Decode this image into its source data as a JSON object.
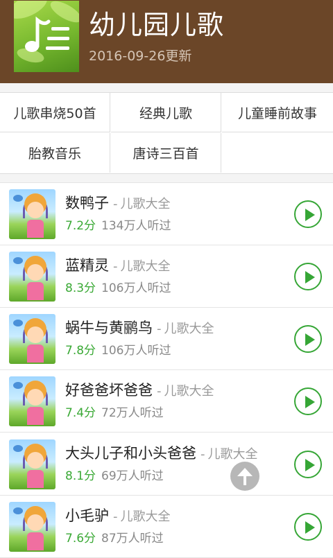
{
  "header": {
    "title": "幼儿园儿歌",
    "updated": "2016-09-26更新",
    "icon": "music-note-icon"
  },
  "categories": [
    {
      "label": "儿歌串烧50首"
    },
    {
      "label": "经典儿歌"
    },
    {
      "label": "儿童睡前故事"
    },
    {
      "label": "胎教音乐"
    },
    {
      "label": "唐诗三百首"
    }
  ],
  "songs": [
    {
      "title": "数鸭子",
      "sep": "-",
      "category": "儿歌大全",
      "score": "7.2分",
      "listens": "134万人听过"
    },
    {
      "title": "蓝精灵",
      "sep": "-",
      "category": "儿歌大全",
      "score": "8.3分",
      "listens": "106万人听过"
    },
    {
      "title": "蜗牛与黄鹂鸟",
      "sep": "-",
      "category": "儿歌大全",
      "score": "7.8分",
      "listens": "106万人听过"
    },
    {
      "title": "好爸爸坏爸爸",
      "sep": "-",
      "category": "儿歌大全",
      "score": "7.4分",
      "listens": "72万人听过"
    },
    {
      "title": "大头儿子和小头爸爸",
      "sep": "-",
      "category": "儿歌大全",
      "score": "8.1分",
      "listens": "69万人听过"
    },
    {
      "title": "小毛驴",
      "sep": "-",
      "category": "儿歌大全",
      "score": "7.6分",
      "listens": "87万人听过"
    }
  ],
  "colors": {
    "header_bg": "#6b4628",
    "accent_green": "#36a636",
    "score_green": "#3aa935"
  },
  "icons": {
    "play": "play-icon",
    "scroll_top": "arrow-up-icon"
  }
}
